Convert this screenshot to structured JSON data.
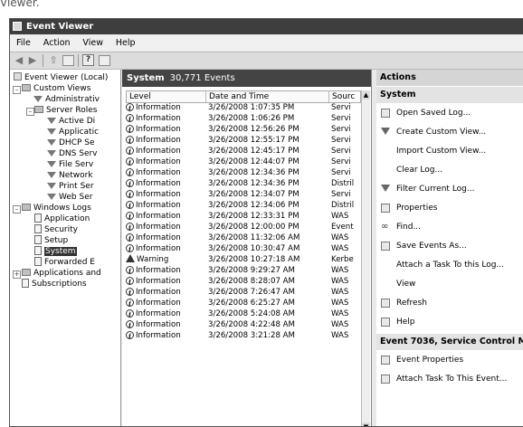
{
  "caption": "Viewer.",
  "window": {
    "title": "Event Viewer"
  },
  "menu": [
    "File",
    "Action",
    "View",
    "Help"
  ],
  "toolbar": {
    "back_icon": "back-arrow-icon",
    "forward_icon": "forward-arrow-icon"
  },
  "tree": {
    "root": "Event Viewer (Local)",
    "custom_views": "Custom Views",
    "administrative": "Administrativ",
    "server_roles": "Server Roles",
    "roles": [
      "Active Di",
      "Applicatic",
      "DHCP Se",
      "DNS Serv",
      "File Serv",
      "Network",
      "Print Ser",
      "Web Ser"
    ],
    "windows_logs": "Windows Logs",
    "logs": [
      "Application",
      "Security",
      "Setup",
      "System",
      "Forwarded E"
    ],
    "apps_services": "Applications and",
    "subscriptions": "Subscriptions"
  },
  "center": {
    "header_title": "System",
    "header_count": "30,771 Events",
    "columns": [
      "Level",
      "Date and Time",
      "Sourc"
    ],
    "rows": [
      {
        "level": "Information",
        "date": "3/26/2008 1:07:35 PM",
        "source": "Servi"
      },
      {
        "level": "Information",
        "date": "3/26/2008 1:06:26 PM",
        "source": "Servi"
      },
      {
        "level": "Information",
        "date": "3/26/2008 12:56:26 PM",
        "source": "Servi"
      },
      {
        "level": "Information",
        "date": "3/26/2008 12:55:17 PM",
        "source": "Servi"
      },
      {
        "level": "Information",
        "date": "3/26/2008 12:45:17 PM",
        "source": "Servi"
      },
      {
        "level": "Information",
        "date": "3/26/2008 12:44:07 PM",
        "source": "Servi"
      },
      {
        "level": "Information",
        "date": "3/26/2008 12:34:36 PM",
        "source": "Servi"
      },
      {
        "level": "Information",
        "date": "3/26/2008 12:34:36 PM",
        "source": "Distril"
      },
      {
        "level": "Information",
        "date": "3/26/2008 12:34:07 PM",
        "source": "Servi"
      },
      {
        "level": "Information",
        "date": "3/26/2008 12:34:06 PM",
        "source": "Distril"
      },
      {
        "level": "Information",
        "date": "3/26/2008 12:33:31 PM",
        "source": "WAS"
      },
      {
        "level": "Information",
        "date": "3/26/2008 12:00:00 PM",
        "source": "Event"
      },
      {
        "level": "Information",
        "date": "3/26/2008 11:32:06 AM",
        "source": "WAS"
      },
      {
        "level": "Information",
        "date": "3/26/2008 10:30:47 AM",
        "source": "WAS"
      },
      {
        "level": "Warning",
        "date": "3/26/2008 10:27:18 AM",
        "source": "Kerbe"
      },
      {
        "level": "Information",
        "date": "3/26/2008 9:29:27 AM",
        "source": "WAS"
      },
      {
        "level": "Information",
        "date": "3/26/2008 8:28:07 AM",
        "source": "WAS"
      },
      {
        "level": "Information",
        "date": "3/26/2008 7:26:47 AM",
        "source": "WAS"
      },
      {
        "level": "Information",
        "date": "3/26/2008 6:25:27 AM",
        "source": "WAS"
      },
      {
        "level": "Information",
        "date": "3/26/2008 5:24:08 AM",
        "source": "WAS"
      },
      {
        "level": "Information",
        "date": "3/26/2008 4:22:48 AM",
        "source": "WAS"
      },
      {
        "level": "Information",
        "date": "3/26/2008 3:21:28 AM",
        "source": "WAS"
      }
    ]
  },
  "actions": {
    "header": "Actions",
    "section1": "System",
    "items1": [
      {
        "label": "Open Saved Log...",
        "icon": "open-log-icon"
      },
      {
        "label": "Create Custom View...",
        "icon": "funnel-icon"
      },
      {
        "label": "Import Custom View...",
        "icon": ""
      },
      {
        "label": "Clear Log...",
        "icon": ""
      },
      {
        "label": "Filter Current Log...",
        "icon": "funnel-icon"
      },
      {
        "label": "Properties",
        "icon": "properties-icon"
      },
      {
        "label": "Find...",
        "icon": "binoculars-icon"
      },
      {
        "label": "Save Events As...",
        "icon": "save-icon"
      },
      {
        "label": "Attach a Task To this Log...",
        "icon": ""
      },
      {
        "label": "View",
        "icon": ""
      },
      {
        "label": "Refresh",
        "icon": "refresh-icon"
      },
      {
        "label": "Help",
        "icon": "help-icon"
      }
    ],
    "section2": "Event 7036, Service Control Ma",
    "items2": [
      {
        "label": "Event Properties",
        "icon": "properties-icon"
      },
      {
        "label": "Attach Task To This Event...",
        "icon": "task-icon"
      }
    ]
  }
}
